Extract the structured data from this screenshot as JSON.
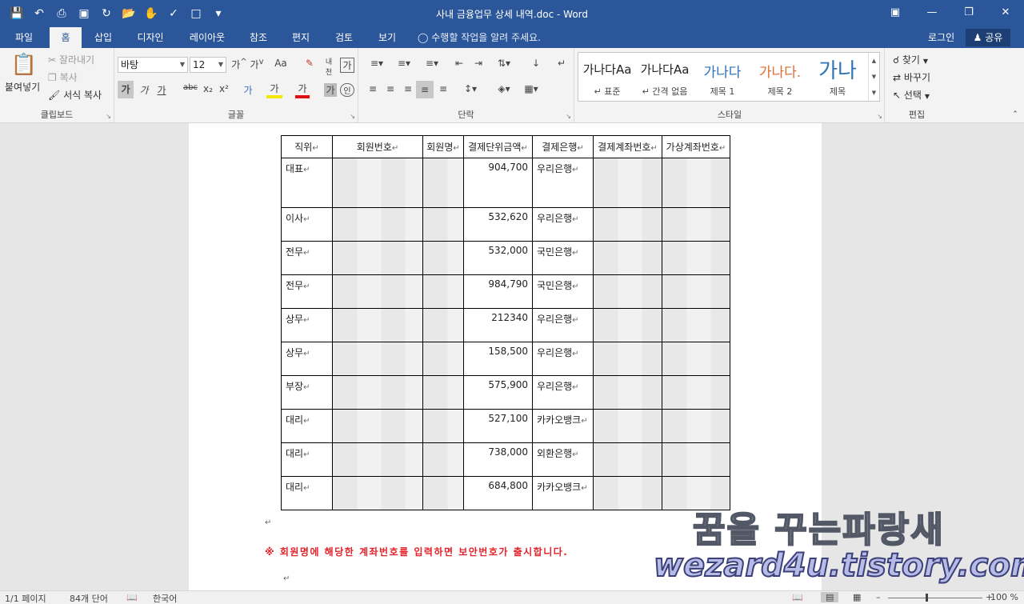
{
  "window": {
    "title": "사내 금융업무 상세 내역.doc - Word"
  },
  "tabs": [
    "파일",
    "홈",
    "삽입",
    "디자인",
    "레이아웃",
    "참조",
    "편지",
    "검토",
    "보기"
  ],
  "tellme": "수행할 작업을 알려 주세요.",
  "account": {
    "signin": "로그인",
    "share": "공유"
  },
  "ribbon": {
    "clipboard": {
      "paste": "붙여넣기",
      "cut": "잘라내기",
      "copy": "복사",
      "format_painter": "서식 복사",
      "label": "클립보드"
    },
    "font": {
      "name": "바탕",
      "size": "12",
      "label": "글꼴"
    },
    "paragraph": {
      "label": "단락"
    },
    "styles": {
      "label": "스타일",
      "items": [
        {
          "preview": "가나다Aa",
          "name": "표준"
        },
        {
          "preview": "가나다Aa",
          "name": "간격 없음"
        },
        {
          "preview": "가나다",
          "name": "제목 1"
        },
        {
          "preview": "가나다.",
          "name": "제목 2"
        },
        {
          "preview": "가나",
          "name": "제목"
        }
      ]
    },
    "editing": {
      "find": "찾기",
      "replace": "바꾸기",
      "select": "선택",
      "label": "편집"
    }
  },
  "table": {
    "headers": [
      "직위",
      "회원번호",
      "회원명",
      "결제단위금액",
      "결제은행",
      "결제계좌번호",
      "가상계좌번호"
    ],
    "rows": [
      {
        "position": "대표",
        "amount": "904,700",
        "bank": "우리은행"
      },
      {
        "position": "이사",
        "amount": "532,620",
        "bank": "우리은행"
      },
      {
        "position": "전무",
        "amount": "532,000",
        "bank": "국민은행"
      },
      {
        "position": "전무",
        "amount": "984,790",
        "bank": "국민은행"
      },
      {
        "position": "상무",
        "amount": "212340",
        "bank": "우리은행"
      },
      {
        "position": "상무",
        "amount": "158,500",
        "bank": "우리은행"
      },
      {
        "position": "부장",
        "amount": "575,900",
        "bank": "우리은행"
      },
      {
        "position": "대리",
        "amount": "527,100",
        "bank": "카카오뱅크"
      },
      {
        "position": "대리",
        "amount": "738,000",
        "bank": "외환은행"
      },
      {
        "position": "대리",
        "amount": "684,800",
        "bank": "카카오뱅크"
      }
    ]
  },
  "notice": "※ 회원명에 해당한 계좌번호를 입력하면 보안번호가 출시합니다.",
  "watermark": {
    "line1": "꿈을 꾸는파랑새",
    "line2": "wezard4u.tistory.com"
  },
  "status": {
    "page": "1/1 페이지",
    "words": "84개 단어",
    "language": "한국어",
    "zoom": "100 %"
  }
}
